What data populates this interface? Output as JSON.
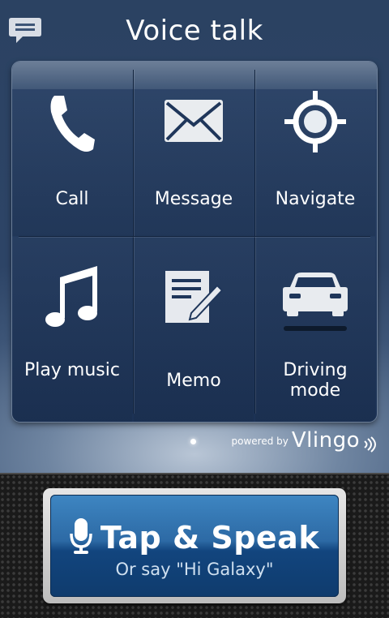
{
  "header": {
    "title": "Voice talk",
    "chat_icon": "chat-bubble-icon"
  },
  "tiles": [
    {
      "label": "Call",
      "icon": "phone-icon"
    },
    {
      "label": "Message",
      "icon": "envelope-icon"
    },
    {
      "label": "Navigate",
      "icon": "crosshair-icon"
    },
    {
      "label": "Play music",
      "icon": "music-note-icon"
    },
    {
      "label": "Memo",
      "icon": "memo-pencil-icon"
    },
    {
      "label": "Driving mode",
      "icon": "car-icon"
    }
  ],
  "page_indicator": {
    "current": 1,
    "total": 1
  },
  "branding": {
    "powered_by": "powered by",
    "brand": "Vlingo"
  },
  "tap_button": {
    "label": "Tap & Speak",
    "sub_label": "Or say \"Hi Galaxy\"",
    "icon": "microphone-icon"
  },
  "colors": {
    "panel": "#1f365a",
    "button_blue": "#2d6aa5",
    "background": "#3d5577"
  }
}
